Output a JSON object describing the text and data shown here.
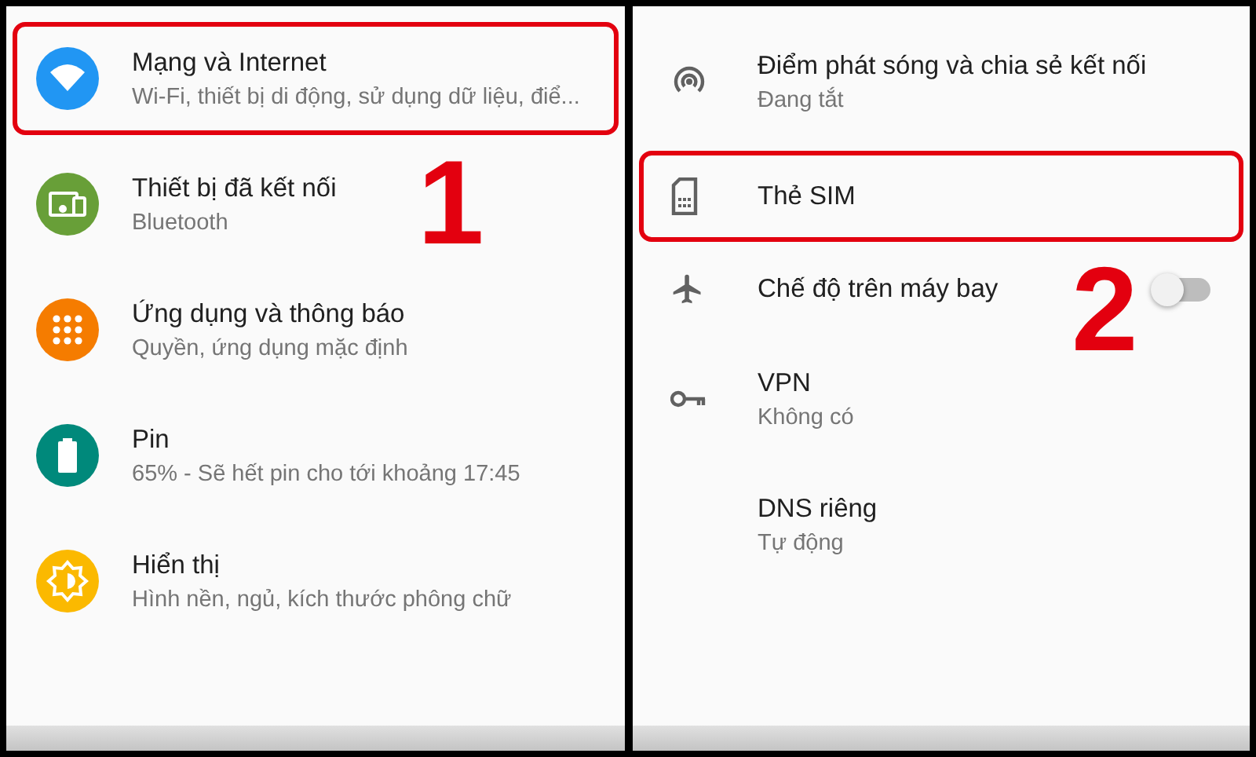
{
  "left_panel": {
    "items": [
      {
        "title": "Mạng và Internet",
        "subtitle": "Wi-Fi, thiết bị di động, sử dụng dữ liệu, điể...",
        "color": "#2196f3",
        "highlighted": true
      },
      {
        "title": "Thiết bị đã kết nối",
        "subtitle": "Bluetooth",
        "color": "#689f38",
        "highlighted": false
      },
      {
        "title": "Ứng dụng và thông báo",
        "subtitle": "Quyền, ứng dụng mặc định",
        "color": "#f57c00",
        "highlighted": false
      },
      {
        "title": "Pin",
        "subtitle": "65% - Sẽ hết pin cho tới khoảng 17:45",
        "color": "#00897b",
        "highlighted": false
      },
      {
        "title": "Hiển thị",
        "subtitle": "Hình nền, ngủ, kích thước phông chữ",
        "color": "#fbb900",
        "highlighted": false
      }
    ],
    "step": "1"
  },
  "right_panel": {
    "items": [
      {
        "kind": "link",
        "title": "Điểm phát sóng và chia sẻ kết nối",
        "subtitle": "Đang tắt",
        "highlighted": false
      },
      {
        "kind": "link",
        "title": "Thẻ SIM",
        "highlighted": true
      },
      {
        "kind": "toggle",
        "title": "Chế độ trên máy bay",
        "on": false,
        "highlighted": false
      },
      {
        "kind": "link",
        "title": "VPN",
        "subtitle": "Không có",
        "highlighted": false
      },
      {
        "kind": "link",
        "title": "DNS riêng",
        "subtitle": "Tự động",
        "highlighted": false
      }
    ],
    "step": "2"
  }
}
